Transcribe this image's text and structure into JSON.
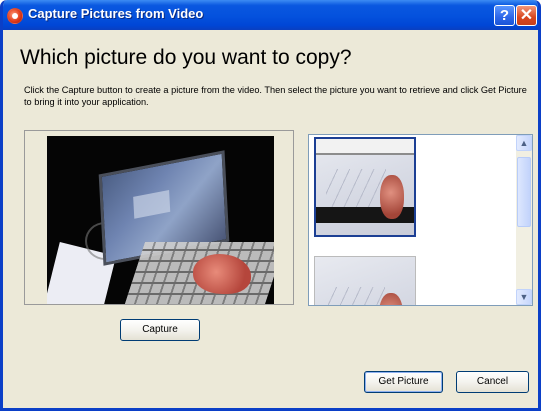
{
  "window": {
    "title": "Capture Pictures from Video",
    "help_label": "?",
    "close_label": "✕"
  },
  "dialog": {
    "heading": "Which picture do you want to copy?",
    "instructions": "Click the Capture button to create a picture from the video.  Then select the picture you want to retrieve and click Get Picture to bring it into your application."
  },
  "preview": {
    "capture_label": "Capture"
  },
  "captured_list": {
    "thumbnails": [
      {
        "selected": true
      },
      {
        "selected": false
      }
    ],
    "scroll_up_icon": "arrow-up-icon",
    "scroll_down_icon": "arrow-down-icon"
  },
  "footer": {
    "get_picture_label": "Get Picture",
    "cancel_label": "Cancel"
  },
  "colors": {
    "titlebar": "#0451dd",
    "window_border": "#0b3fc7",
    "dialog_bg": "#ece9d8",
    "button_border": "#003c74"
  }
}
